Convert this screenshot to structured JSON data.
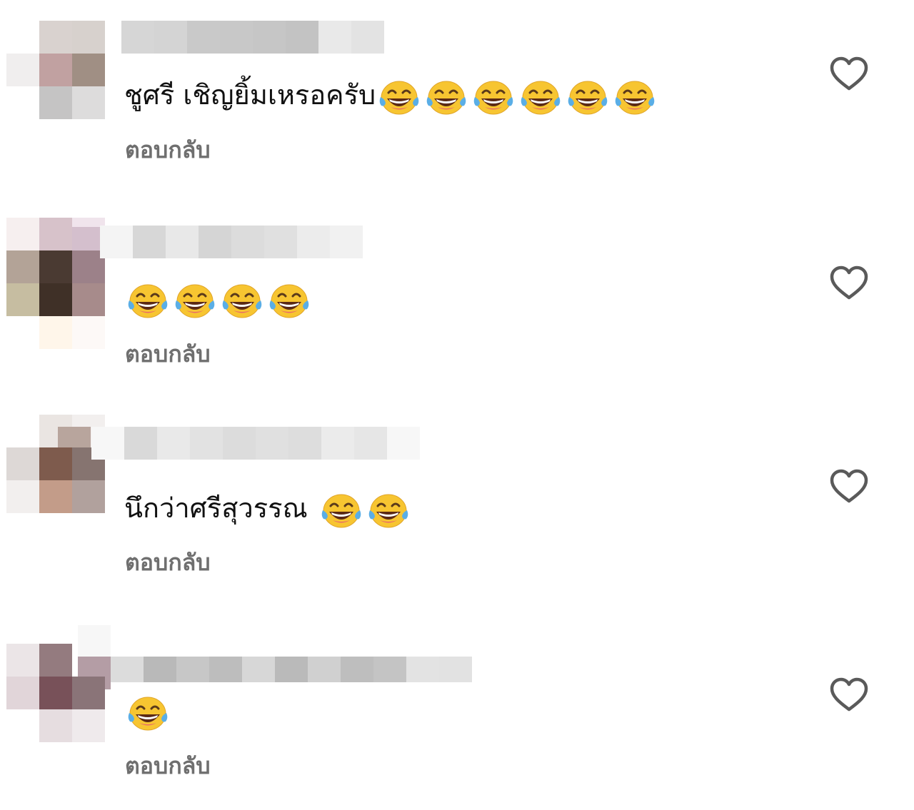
{
  "comments": [
    {
      "text": "ชูศรี เชิญยิ้มเหรอครับ",
      "emoji_count": 6,
      "emoji_name": "face-with-tears-of-joy-icon",
      "reply_label": "ตอบกลับ",
      "like_icon": "heart-outline-icon"
    },
    {
      "text": "",
      "emoji_count": 4,
      "emoji_name": "face-with-tears-of-joy-icon",
      "reply_label": "ตอบกลับ",
      "like_icon": "heart-outline-icon"
    },
    {
      "text": "นึกว่าศรีสุวรรณ",
      "emoji_count": 2,
      "emoji_name": "face-with-tears-of-joy-icon",
      "reply_label": "ตอบกลับ",
      "like_icon": "heart-outline-icon"
    },
    {
      "text": "",
      "emoji_count": 1,
      "emoji_name": "face-with-tears-of-joy-icon",
      "reply_label": "ตอบกลับ",
      "like_icon": "heart-outline-icon"
    }
  ],
  "colors": {
    "text": "#111111",
    "reply": "#6f6f6f",
    "heart_stroke": "#5a5a5a",
    "emoji_face": "#f7c531",
    "emoji_tear": "#5aaee6"
  }
}
